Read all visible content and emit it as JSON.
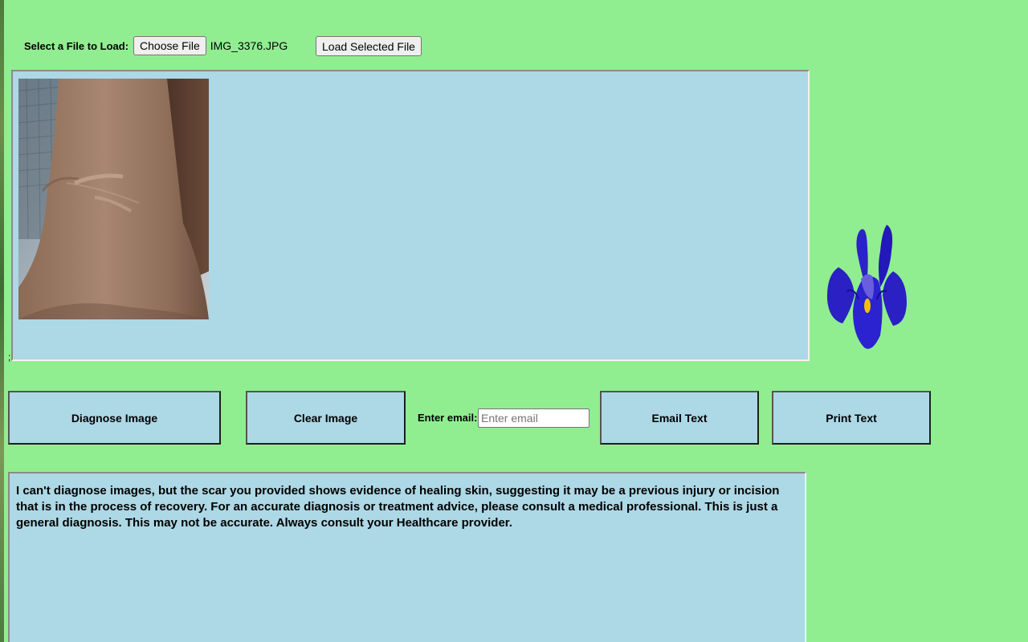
{
  "file_loader": {
    "label": "Select a File to Load:",
    "choose_button": "Choose File",
    "file_name": "IMG_3376.JPG",
    "load_button": "Load Selected File"
  },
  "image_panel": {
    "stray_text": ";"
  },
  "actions": {
    "diagnose_label": "Diagnose Image",
    "clear_label": "Clear Image",
    "email_label": "Enter email:",
    "email_placeholder": "Enter email",
    "email_value": "",
    "email_button": "Email Text",
    "print_button": "Print Text"
  },
  "result": {
    "text": "I can't diagnose images, but the scar you provided shows evidence of healing skin, suggesting it may be a previous injury or incision that is in the process of recovery. For an accurate diagnosis or treatment advice, please consult a medical professional. This is just a general diagnosis. This may not be accurate. Always consult your Healthcare provider."
  },
  "colors": {
    "page_background": "#90ee90",
    "panel_background": "#add8e6",
    "flower_color": "#2a22c8"
  },
  "icons": {
    "flower": "iris-flower-icon"
  }
}
